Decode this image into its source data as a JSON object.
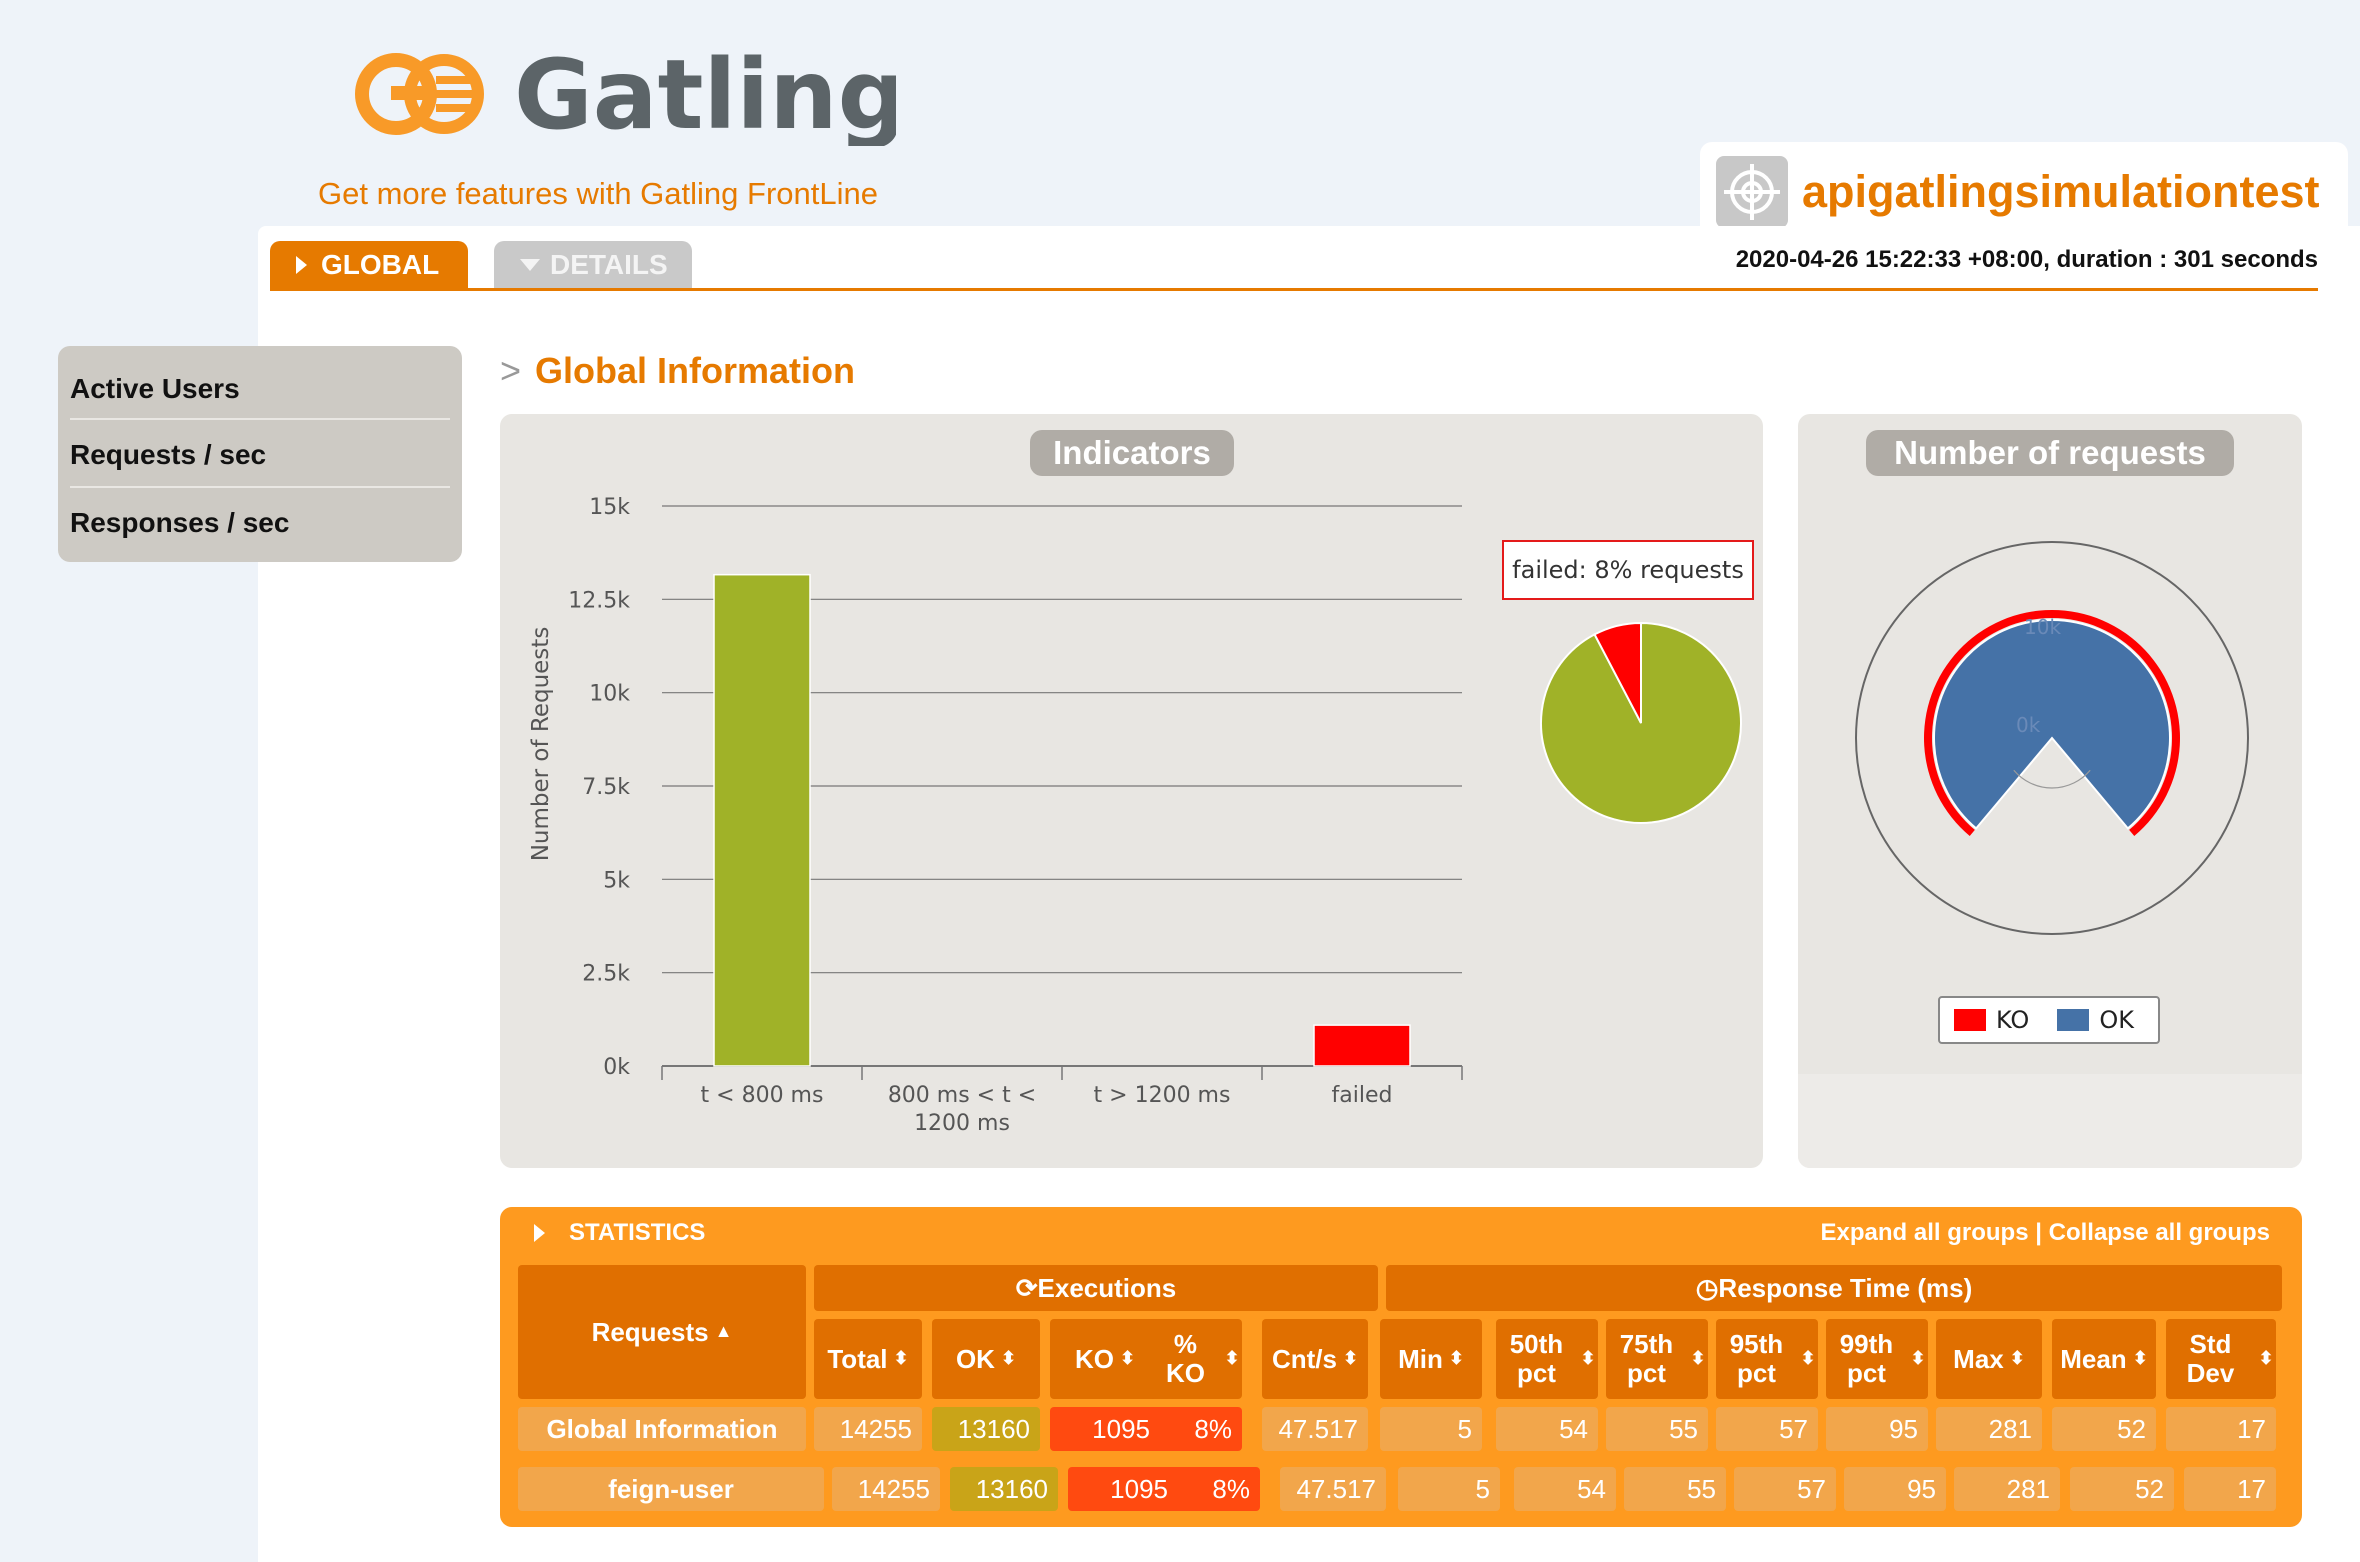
{
  "header": {
    "brand": "Gatling",
    "promo": "Get more features with Gatling FrontLine",
    "simulation_name": "apigatlingsimulationtest",
    "run_info": "2020-04-26 15:22:33 +08:00, duration : 301 seconds"
  },
  "tabs": [
    {
      "label": "GLOBAL"
    },
    {
      "label": "DETAILS"
    }
  ],
  "sidebar": {
    "items": [
      {
        "label": "Active Users"
      },
      {
        "label": "Requests / sec"
      },
      {
        "label": "Responses / sec"
      }
    ]
  },
  "section_title": "Global Information",
  "indicators": {
    "title": "Indicators",
    "tooltip": "failed: 8% requests"
  },
  "requests_panel": {
    "title": "Number of requests",
    "legend": [
      "KO",
      "OK"
    ]
  },
  "colors": {
    "accent": "#e67a00",
    "ok_bar": "#a0b228",
    "failed": "#ff0000",
    "ok_blue": "#4572a7"
  },
  "chart_data": [
    {
      "type": "bar",
      "title": "Indicators",
      "ylabel": "Number of Requests",
      "categories": [
        "t < 800 ms",
        "800 ms < t < 1200 ms",
        "t > 1200 ms",
        "failed"
      ],
      "values": [
        13160,
        0,
        0,
        1095
      ],
      "ylim": [
        0,
        15000
      ],
      "yticks": [
        "0k",
        "2.5k",
        "5k",
        "7.5k",
        "10k",
        "12.5k",
        "15k"
      ],
      "grid": true
    },
    {
      "type": "pie",
      "labels": [
        "t < 800 ms",
        "failed"
      ],
      "values": [
        13160,
        1095
      ]
    },
    {
      "type": "area",
      "title": "Number of requests",
      "series": [
        {
          "name": "KO",
          "value": 1095
        },
        {
          "name": "OK",
          "value": 13160
        }
      ],
      "tick_labels": [
        "0k",
        "10k"
      ],
      "legend": "bottom"
    }
  ],
  "statistics": {
    "title": "STATISTICS",
    "links": "Expand all groups | Collapse all groups",
    "group_executions": "Executions",
    "group_response": "Response Time (ms)",
    "requests_header": "Requests",
    "columns": [
      "Total",
      "OK",
      "KO",
      "% KO",
      "Cnt/s",
      "Min",
      "50th pct",
      "75th pct",
      "95th pct",
      "99th pct",
      "Max",
      "Mean",
      "Std Dev"
    ],
    "rows": [
      {
        "name": "Global Information",
        "values": [
          "14255",
          "13160",
          "1095",
          "8%",
          "47.517",
          "5",
          "54",
          "55",
          "57",
          "95",
          "281",
          "52",
          "17"
        ]
      },
      {
        "name": "feign-user",
        "values": [
          "14255",
          "13160",
          "1095",
          "8%",
          "47.517",
          "5",
          "54",
          "55",
          "57",
          "95",
          "281",
          "52",
          "17"
        ]
      }
    ]
  }
}
